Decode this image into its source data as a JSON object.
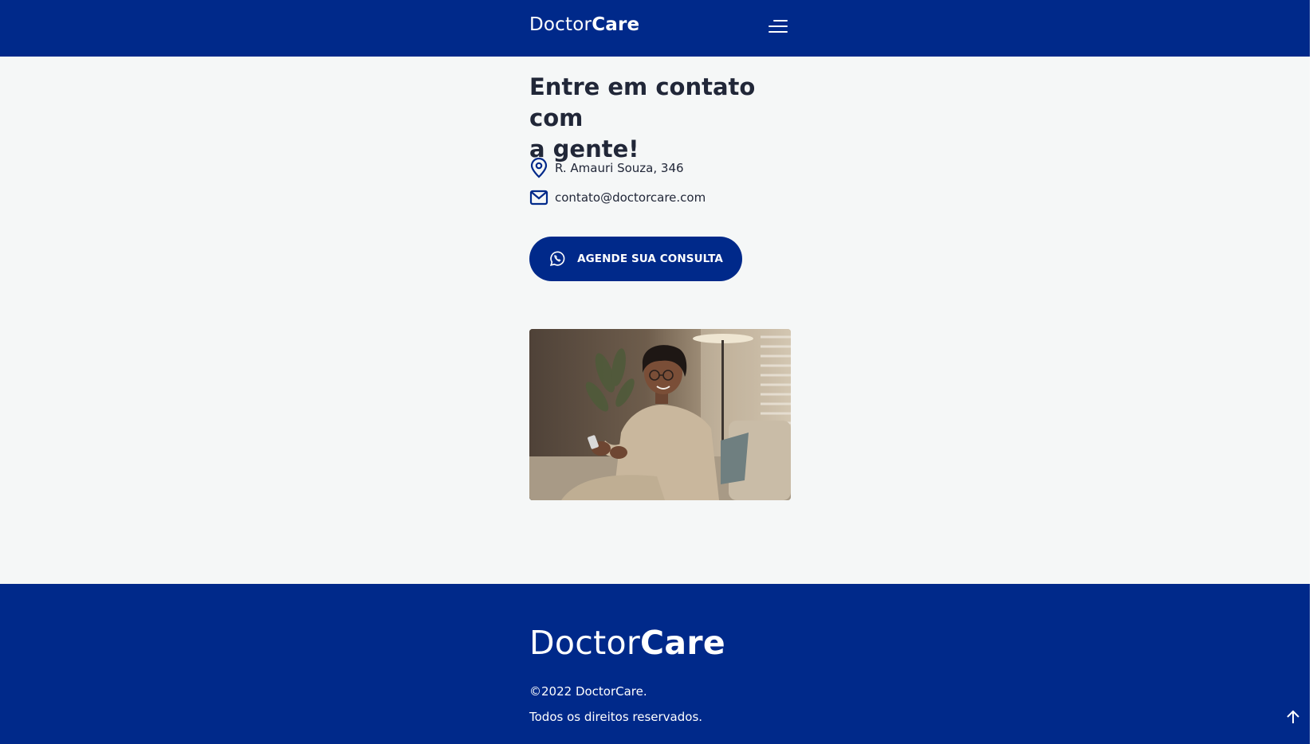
{
  "header": {
    "logo_light": "Doctor",
    "logo_bold": "Care",
    "menu_icon": "menu-icon"
  },
  "contact": {
    "title_line1": "Entre em contato com",
    "title_line2": "a gente!",
    "address": "R. Amauri Souza, 346",
    "address_icon": "map-pin-icon",
    "email": "contato@doctorcare.com",
    "email_icon": "mail-icon",
    "cta_label": "AGENDE SUA CONSULTA",
    "cta_icon": "whatsapp-icon"
  },
  "footer": {
    "logo_light": "Doctor",
    "logo_bold": "Care",
    "copyright": "©2022 DoctorCare.",
    "rights": "Todos os direitos reservados.",
    "back_to_top_icon": "arrow-up-icon"
  },
  "colors": {
    "brand": "#00298A",
    "background": "#F5F7F7",
    "text": "#212738",
    "white": "#FFFFFF"
  }
}
